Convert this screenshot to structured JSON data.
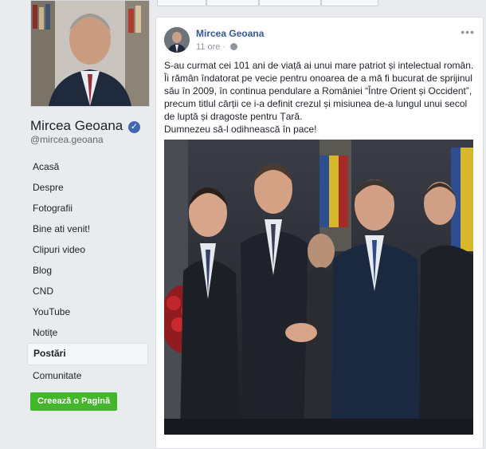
{
  "sidebar": {
    "page_name": "Mircea Geoana",
    "handle": "@mircea.geoana",
    "items": [
      {
        "label": "Acasă"
      },
      {
        "label": "Despre"
      },
      {
        "label": "Fotografii"
      },
      {
        "label": "Bine ati venit!"
      },
      {
        "label": "Clipuri video"
      },
      {
        "label": "Blog"
      },
      {
        "label": "CND"
      },
      {
        "label": "YouTube"
      },
      {
        "label": "Notițe"
      },
      {
        "label": "Postări",
        "active": true
      },
      {
        "label": "Comunitate"
      }
    ],
    "create_page_label": "Creează o Pagină"
  },
  "post": {
    "author": "Mircea Geoana",
    "time": "11 ore",
    "separator": "·",
    "text_1": "S-au curmat cei 101 ani de viață ai unui mare patriot și intelectual român. Îi rămân îndatorat pe vecie pentru onoarea de a mă fi bucurat de sprijinul său în 2009, în continua pendulare a României “Între Orient și Occident”, precum titlul cărții ce i-a definit crezul și misiunea de-a lungul unui secol de luptă și dragoste pentru Țară.",
    "text_2": "Dumnezeu să-l odihnească în pace!"
  },
  "colors": {
    "background": "#e9ebee",
    "link": "#365899",
    "verified": "#4267b2",
    "create_button": "#42b72a"
  },
  "icons": [
    "verified-badge-icon",
    "globe-icon",
    "more-options-icon"
  ]
}
